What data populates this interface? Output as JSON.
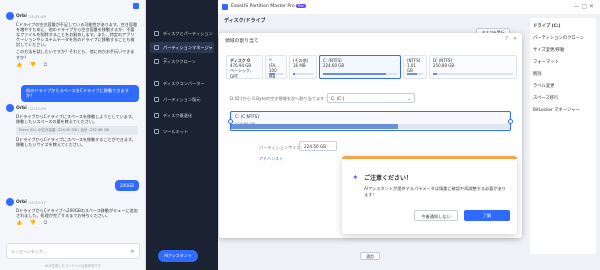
{
  "chat": {
    "messages": [
      {
        "who": "Orbi",
        "time": "13:31:49",
        "text": "Cドライブの空き容量が不足している可能性があります。空き容量を増やすために、他のドライブから空き容量を移動するか、不要なファイルを削除することをお勧めします。また、特定のアプリケーションやシステムデータを別のドライブに移動することも検討してください。",
        "text2": "この方法を試したいですか？それとも、他に何かお手伝いできますか？"
      },
      {
        "who": "Orbi",
        "time": "13:32:09",
        "text": "DドライブからCドライブにスペースを移動しようとしています。移動したいスペースの量を教えてください。",
        "sys": "Drive (D:) の空き容量: 224.50 GB / 合計: 232.88 GB",
        "text2": "DドライブからCドライブにスペースを移動することができます。移動したいサイズを教えてください。"
      },
      {
        "who": "Orbi",
        "time": "13:33:17",
        "text": "DドライブからCドライブへ200GBのスペース移動がキューに追加されました。処理が完了するまでお待ちください。"
      }
    ],
    "user_msg_1": "他のドライブからスペースをCドライブに移動できますか？",
    "user_msg_2": "200GB",
    "input_placeholder": "メッセージを入力...",
    "footer": "AIが生成したコンテンツは参考用です"
  },
  "app": {
    "title": "EaseUS Partition Master Pro",
    "pro_badge": "Pro",
    "sidebar": [
      {
        "label": "ディスクとパーティション",
        "icon": "disk-icon"
      },
      {
        "label": "パーティションマネージャー",
        "icon": "partition-icon"
      },
      {
        "label": "ディスククローン",
        "icon": "clone-icon"
      },
      {
        "label": "ディスクコンバーター",
        "icon": "convert-icon"
      },
      {
        "label": "パーティション復元",
        "icon": "restore-icon"
      },
      {
        "label": "ディスク最適化",
        "icon": "optimize-icon"
      },
      {
        "label": "ツールキット",
        "icon": "toolkit-icon"
      }
    ],
    "header_section": "ディスク/ドライブ",
    "right_panel": [
      "ドライブ (C:)",
      "パーティションのクローン",
      "サイズ変更/移動",
      "フォーマット",
      "削除",
      "ラベル変更",
      "スペース移行",
      "BitLocker マネージャー"
    ],
    "execute_label": "タスクを実行",
    "ai_button": "AIアシスタント",
    "apply_label": "適用"
  },
  "dialog": {
    "title": "領域の割り当て",
    "disk_name": "ディスク 0",
    "disk_size": "476.94 GB",
    "disk_type": "ベーシック, GPT",
    "partitions": [
      {
        "label": "*: (FA...",
        "size": "100 MB",
        "fill": 0.4
      },
      {
        "label": "(その他)",
        "size": "16 MB",
        "fill": 0.1
      },
      {
        "label": "C: (NTFS)",
        "size": "224.60 GB",
        "fill": 0.85
      },
      {
        "label": "(NTFS)",
        "size": "1.01 GB",
        "fill": 0.6
      },
      {
        "label": "D: (NTFS)",
        "size": "250.89 GB",
        "fill": 0.05
      }
    ],
    "allocate_label": "D:(D:)から 0 Byteの空き領域を次へ割り当てます：",
    "allocate_target": "C: (C:)",
    "target_name": "C: (C:NTFS)",
    "target_size": "224.60 GB",
    "size_label": "パーティションサイズ：",
    "size_value": "224.50 GB",
    "advanced": "アドバンスト",
    "cancel": "キャンセル",
    "ok": "OK"
  },
  "alert": {
    "title": "ご注意ください！",
    "body": "AIアシスタントが提供するパラメータは慎重に確認や再調整する必要があります！",
    "secondary": "今後通知しない",
    "primary": "了解"
  }
}
